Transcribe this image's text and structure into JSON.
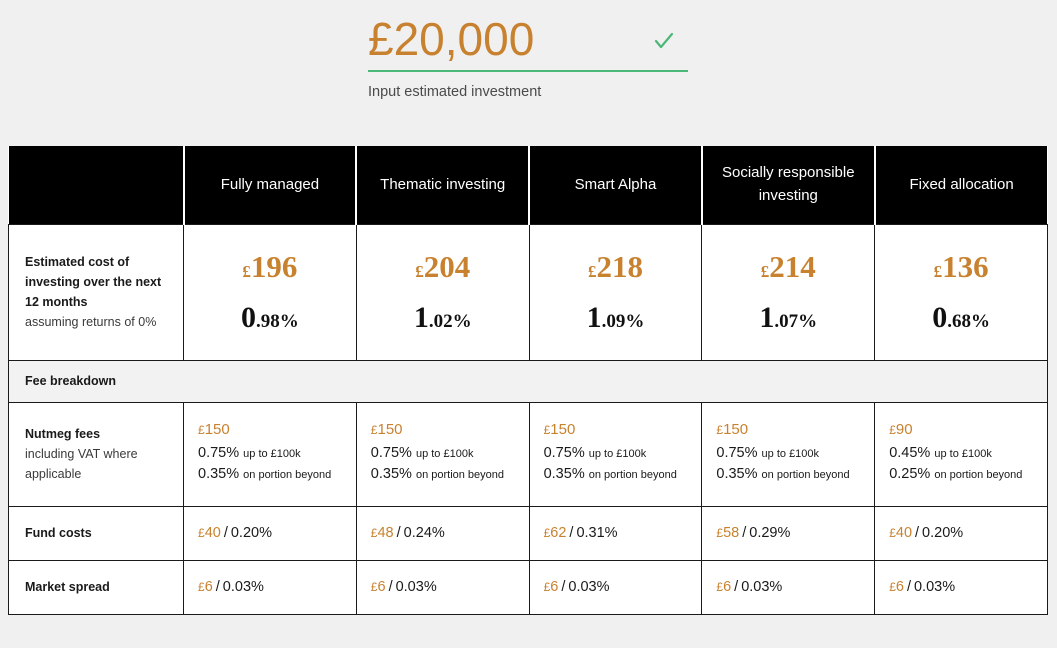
{
  "investment_input": {
    "value": "£20,000",
    "currency_symbol": "£",
    "amount": "20,000",
    "label": "Input estimated investment",
    "valid_icon": "check-icon",
    "accent_color": "#c8822f",
    "valid_color": "#4cb878"
  },
  "table": {
    "columns": [
      {
        "label": ""
      },
      {
        "label": "Fully managed"
      },
      {
        "label": "Thematic investing"
      },
      {
        "label": "Smart Alpha"
      },
      {
        "label": "Socially responsible investing"
      },
      {
        "label": "Fixed allocation"
      }
    ],
    "cost_row": {
      "label_strong": "Estimated cost of investing over the next 12 months",
      "label_sub": "assuming returns of 0%",
      "cells": [
        {
          "currency": "£",
          "amount": "196",
          "pct_big": "0",
          "pct_small": ".98%"
        },
        {
          "currency": "£",
          "amount": "204",
          "pct_big": "1",
          "pct_small": ".02%"
        },
        {
          "currency": "£",
          "amount": "218",
          "pct_big": "1",
          "pct_small": ".09%"
        },
        {
          "currency": "£",
          "amount": "214",
          "pct_big": "1",
          "pct_small": ".07%"
        },
        {
          "currency": "£",
          "amount": "136",
          "pct_big": "0",
          "pct_small": ".68%"
        }
      ]
    },
    "band_label": "Fee breakdown",
    "nutmeg_row": {
      "label_strong": "Nutmeg fees",
      "label_sub": "including VAT where applicable",
      "cells": [
        {
          "currency": "£",
          "amount": "150",
          "pct1": "0.75%",
          "note1": "up to £100k",
          "pct2": "0.35%",
          "note2": "on portion beyond"
        },
        {
          "currency": "£",
          "amount": "150",
          "pct1": "0.75%",
          "note1": "up to £100k",
          "pct2": "0.35%",
          "note2": "on portion beyond"
        },
        {
          "currency": "£",
          "amount": "150",
          "pct1": "0.75%",
          "note1": "up to £100k",
          "pct2": "0.35%",
          "note2": "on portion beyond"
        },
        {
          "currency": "£",
          "amount": "150",
          "pct1": "0.75%",
          "note1": "up to £100k",
          "pct2": "0.35%",
          "note2": "on portion beyond"
        },
        {
          "currency": "£",
          "amount": "90",
          "pct1": "0.45%",
          "note1": "up to £100k",
          "pct2": "0.25%",
          "note2": "on portion beyond"
        }
      ]
    },
    "fund_costs_row": {
      "label": "Fund costs",
      "cells": [
        {
          "currency": "£",
          "amount": "40",
          "separator": "/",
          "pct": "0.20%"
        },
        {
          "currency": "£",
          "amount": "48",
          "separator": "/",
          "pct": "0.24%"
        },
        {
          "currency": "£",
          "amount": "62",
          "separator": "/",
          "pct": "0.31%"
        },
        {
          "currency": "£",
          "amount": "58",
          "separator": "/",
          "pct": "0.29%"
        },
        {
          "currency": "£",
          "amount": "40",
          "separator": "/",
          "pct": "0.20%"
        }
      ]
    },
    "market_spread_row": {
      "label": "Market spread",
      "cells": [
        {
          "currency": "£",
          "amount": "6",
          "separator": "/",
          "pct": "0.03%"
        },
        {
          "currency": "£",
          "amount": "6",
          "separator": "/",
          "pct": "0.03%"
        },
        {
          "currency": "£",
          "amount": "6",
          "separator": "/",
          "pct": "0.03%"
        },
        {
          "currency": "£",
          "amount": "6",
          "separator": "/",
          "pct": "0.03%"
        },
        {
          "currency": "£",
          "amount": "6",
          "separator": "/",
          "pct": "0.03%"
        }
      ]
    }
  }
}
